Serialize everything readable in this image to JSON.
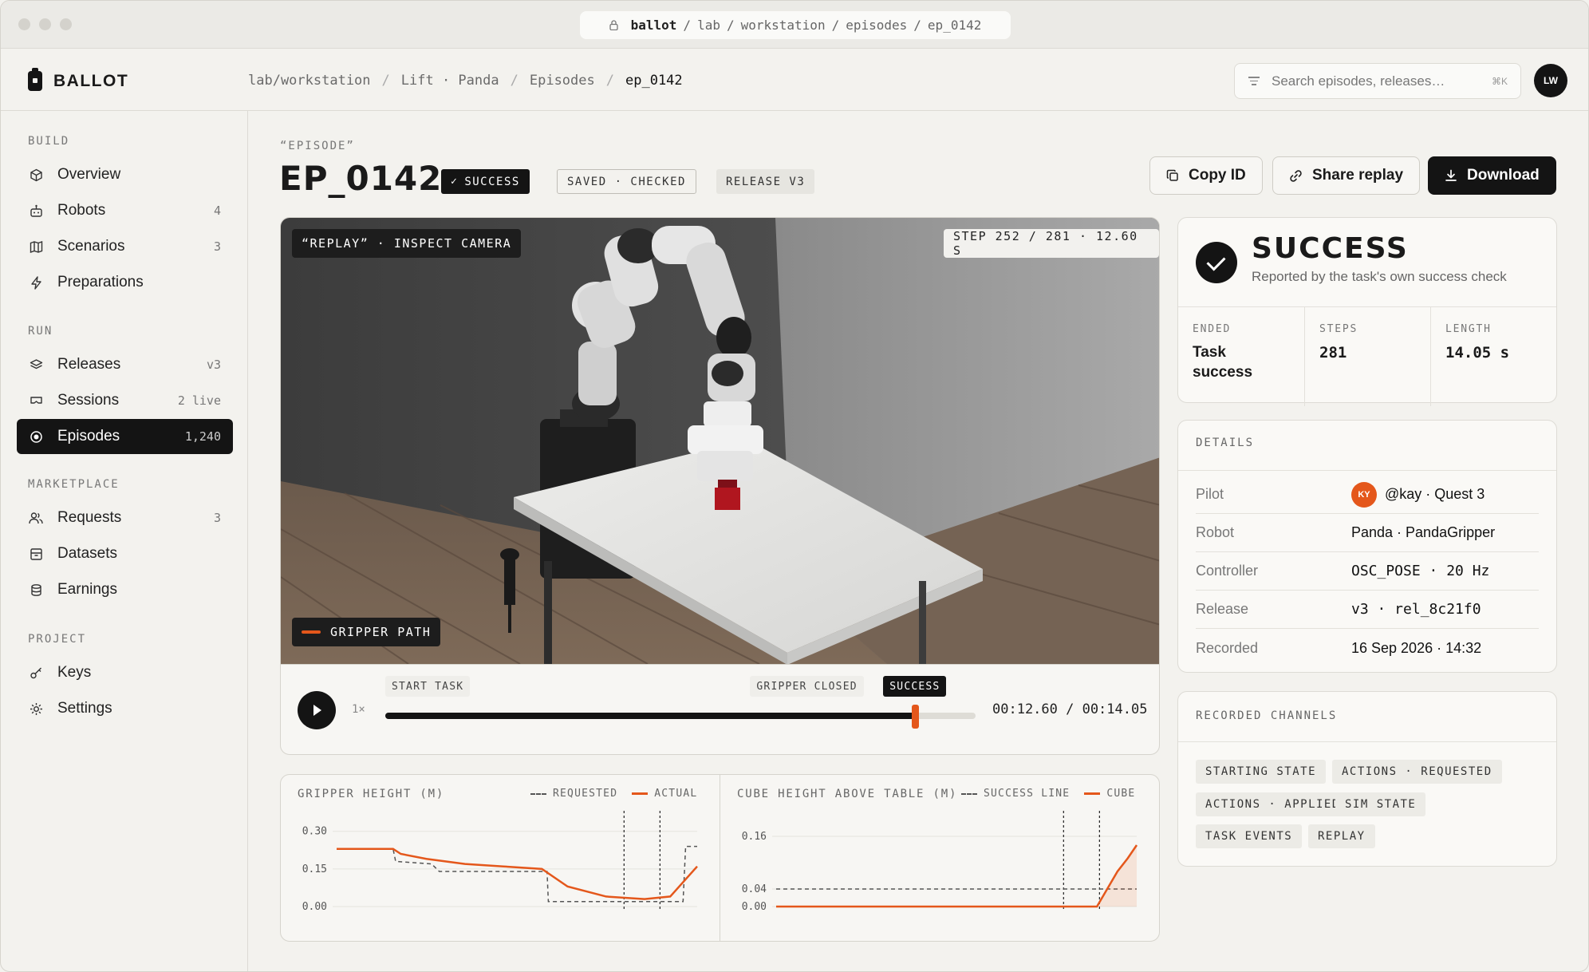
{
  "window": {
    "url_host": "ballot",
    "url_path": [
      "lab",
      "workstation",
      "episodes",
      "ep_0142"
    ]
  },
  "app": {
    "name": "BALLOT"
  },
  "breadcrumb": {
    "items": [
      "lab/workstation",
      "Lift · Panda",
      "Episodes"
    ],
    "current": "ep_0142"
  },
  "search": {
    "placeholder": "Search episodes, releases…",
    "shortcut": "⌘K"
  },
  "user": {
    "initials": "LW"
  },
  "sidebar": {
    "sections": [
      {
        "label": "BUILD",
        "items": [
          {
            "label": "Overview",
            "icon": "cube-icon",
            "count": ""
          },
          {
            "label": "Robots",
            "icon": "robot-icon",
            "count": "4"
          },
          {
            "label": "Scenarios",
            "icon": "map-icon",
            "count": "3"
          },
          {
            "label": "Preparations",
            "icon": "bolt-icon",
            "count": ""
          }
        ]
      },
      {
        "label": "RUN",
        "items": [
          {
            "label": "Releases",
            "icon": "layers-icon",
            "count": "v3"
          },
          {
            "label": "Sessions",
            "icon": "headset-icon",
            "count": "2 live"
          },
          {
            "label": "Episodes",
            "icon": "record-icon",
            "count": "1,240",
            "active": true
          }
        ]
      },
      {
        "label": "MARKETPLACE",
        "items": [
          {
            "label": "Requests",
            "icon": "users-icon",
            "count": "3"
          },
          {
            "label": "Datasets",
            "icon": "archive-icon",
            "count": ""
          },
          {
            "label": "Earnings",
            "icon": "coins-icon",
            "count": ""
          }
        ]
      },
      {
        "label": "PROJECT",
        "items": [
          {
            "label": "Keys",
            "icon": "key-icon",
            "count": ""
          },
          {
            "label": "Settings",
            "icon": "gear-icon",
            "count": ""
          }
        ]
      }
    ]
  },
  "episode": {
    "kicker": "“EPISODE”",
    "title": "EP_0142",
    "badges": [
      "SUCCESS",
      "SAVED · CHECKED",
      "RELEASE V3"
    ]
  },
  "actions": {
    "copy_id": "Copy ID",
    "share": "Share replay",
    "download": "Download"
  },
  "viewer": {
    "camera_label": "“REPLAY” · INSPECT CAMERA",
    "step_label": "STEP 252 / 281 · 12.60 S",
    "path_label": "GRIPPER PATH",
    "speed": "1×",
    "progress": 0.897,
    "time": "00:12.60 / 00:14.05",
    "markers": [
      {
        "label": "START TASK",
        "pos": 0.0
      },
      {
        "label": "GRIPPER CLOSED",
        "pos": 0.81
      },
      {
        "label": "SUCCESS",
        "pos": 0.897
      }
    ]
  },
  "outcome": {
    "title": "SUCCESS",
    "subtitle": "Reported by the task's own success check",
    "stats": [
      {
        "key": "ENDED",
        "value": "Task success"
      },
      {
        "key": "STEPS",
        "value": "281"
      },
      {
        "key": "LENGTH",
        "value": "14.05 s"
      }
    ]
  },
  "details": {
    "heading": "DETAILS",
    "pilot_initials": "KY",
    "rows": [
      {
        "key": "Pilot",
        "value": "@kay · Quest 3"
      },
      {
        "key": "Robot",
        "value": "Panda · PandaGripper"
      },
      {
        "key": "Controller",
        "value": "OSC_POSE · 20 Hz"
      },
      {
        "key": "Release",
        "value": "v3 · rel_8c21f0"
      },
      {
        "key": "Recorded",
        "value": "16 Sep 2026 · 14:32"
      }
    ]
  },
  "channels": {
    "heading": "RECORDED CHANNELS",
    "chips": [
      "STARTING STATE",
      "ACTIONS · REQUESTED",
      "ACTIONS · APPLIED",
      "SIM STATE",
      "TASK EVENTS",
      "REPLAY"
    ]
  },
  "chart_data": [
    {
      "type": "line",
      "title": "GRIPPER HEIGHT (M)",
      "yticks": [
        "0.30",
        "0.15",
        "0.00"
      ],
      "ylim": [
        0,
        0.35
      ],
      "xlim": [
        0,
        14.05
      ],
      "vlines": [
        11.2,
        12.6
      ],
      "series": [
        {
          "name": "REQUESTED",
          "style": "dashed",
          "color": "#555555",
          "x": [
            0,
            2.2,
            2.3,
            3.7,
            4.0,
            5.5,
            8.2,
            8.25,
            13.5,
            13.6,
            14.05
          ],
          "y": [
            0.23,
            0.23,
            0.18,
            0.17,
            0.14,
            0.14,
            0.14,
            0.02,
            0.02,
            0.24,
            0.24
          ]
        },
        {
          "name": "ACTUAL",
          "style": "solid",
          "color": "#e4571b",
          "x": [
            0,
            2.2,
            2.5,
            3.5,
            5.0,
            6.5,
            8.0,
            9.0,
            10.5,
            12.0,
            13.0,
            14.05
          ],
          "y": [
            0.23,
            0.23,
            0.21,
            0.19,
            0.17,
            0.16,
            0.15,
            0.08,
            0.04,
            0.03,
            0.04,
            0.16
          ]
        }
      ]
    },
    {
      "type": "area",
      "title": "CUBE HEIGHT ABOVE TABLE (M)",
      "yticks": [
        "0.16",
        "0.04",
        "0.00"
      ],
      "ylim": [
        0,
        0.2
      ],
      "xlim": [
        0,
        14.05
      ],
      "vlines": [
        11.2,
        12.6
      ],
      "series": [
        {
          "name": "SUCCESS LINE",
          "style": "dashed",
          "color": "#555555",
          "x": [
            0,
            14.05
          ],
          "y": [
            0.04,
            0.04
          ]
        },
        {
          "name": "CUBE",
          "style": "solid",
          "color": "#e4571b",
          "x": [
            0,
            12.5,
            12.9,
            13.3,
            13.7,
            14.05
          ],
          "y": [
            0.0,
            0.0,
            0.04,
            0.08,
            0.11,
            0.14
          ]
        }
      ]
    }
  ]
}
